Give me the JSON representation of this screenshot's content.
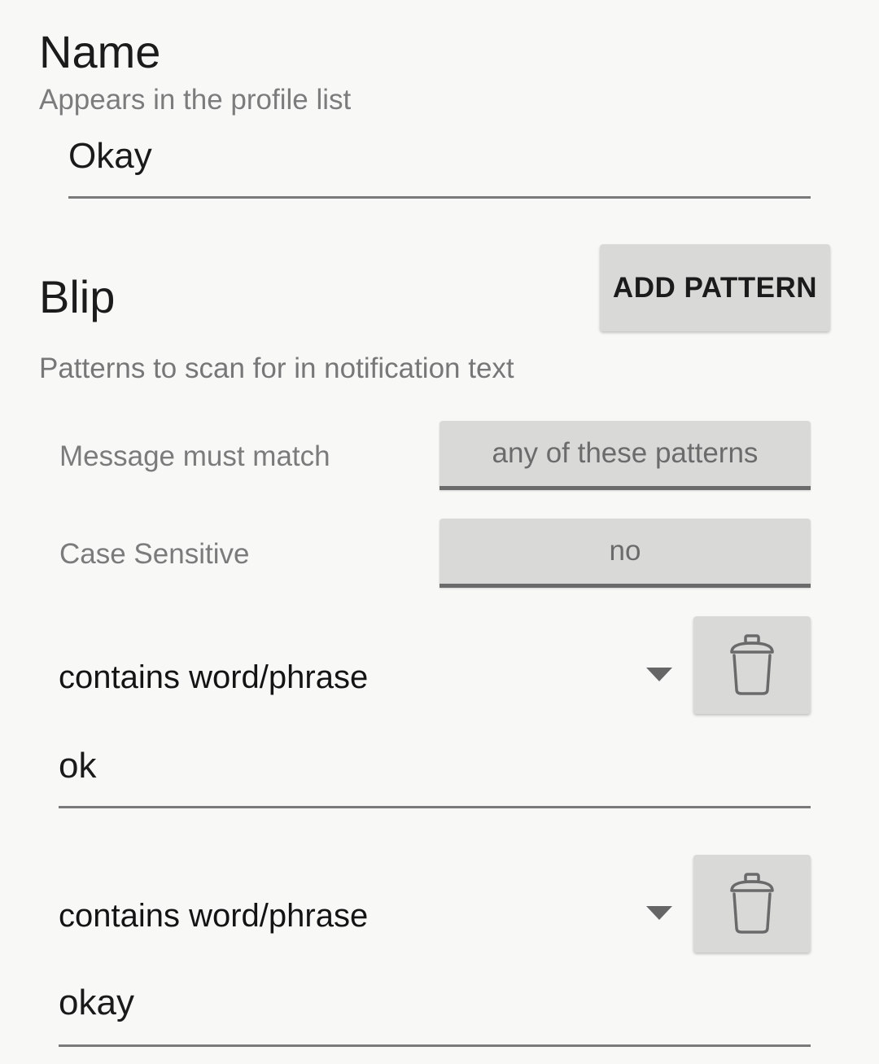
{
  "name_section": {
    "title": "Name",
    "subtitle": "Appears in the profile list",
    "value": "Okay"
  },
  "blip_section": {
    "title": "Blip",
    "add_button": "ADD PATTERN",
    "subtitle": "Patterns to scan for in notification text"
  },
  "settings": {
    "match_label": "Message must match",
    "match_value": "any of these patterns",
    "case_label": "Case Sensitive",
    "case_value": "no"
  },
  "patterns": [
    {
      "type": "contains word/phrase",
      "value": "ok"
    },
    {
      "type": "contains word/phrase",
      "value": "okay"
    }
  ],
  "icons": {
    "dropdown": "dropdown-arrow-icon",
    "delete": "trash-icon"
  }
}
